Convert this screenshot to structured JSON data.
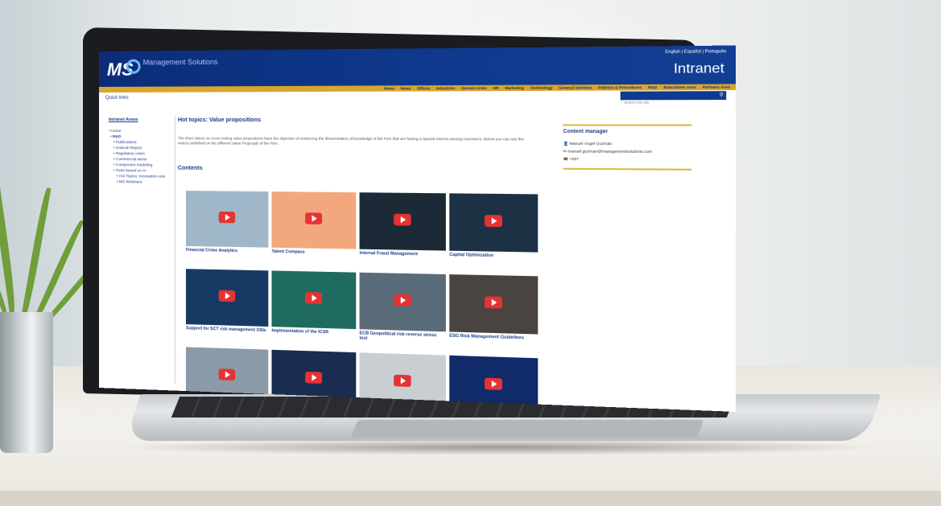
{
  "header": {
    "logo_mark": "MS",
    "logo_text": "Management Solutions",
    "languages": "English | Español | Português",
    "title": "Intranet"
  },
  "nav": [
    "Home",
    "News",
    "Offices",
    "Industries",
    "Service Lines",
    "HR",
    "Marketing",
    "Technology",
    "General Services",
    "Policies & Procedures",
    "R&D",
    "Executives Area",
    "Partners Area"
  ],
  "quick_links": "Quick links",
  "search": {
    "placeholder": "Search this site"
  },
  "sidebar": {
    "title": "Intranet Areas",
    "items": [
      "• Home",
      "• R&D",
      "• Publications",
      "• Outlook Report",
      "• Regulatory notes",
      "• Commercial alerts",
      "• Component modeling",
      "• Tools based on AI",
      "• Hot Topics: Innovation Axis",
      "• MS Webinars"
    ]
  },
  "main": {
    "title": "Hot topics: Value propositions",
    "intro": "The short videos on cross-cutting value propositions have the objective of reinforcing the dissemination of knowledge of the Firm that are having a special interest among customers. Below you can see the videos published on the different Value Proposals of the Firm.",
    "contents_label": "Contents",
    "cards": [
      {
        "caption": "Financial Crime Analytics",
        "bg": "#9fb7c9"
      },
      {
        "caption": "Talent Compass",
        "bg": "#f3a77d"
      },
      {
        "caption": "Internal Fraud Management",
        "bg": "#1c2a38"
      },
      {
        "caption": "Capital Optimization",
        "bg": "#1d3144"
      },
      {
        "caption": "Support for SCT risk management OSIs",
        "bg": "#163a63"
      },
      {
        "caption": "Implementation of the ICSR",
        "bg": "#1f6b62"
      },
      {
        "caption": "ECB Geopolitical risk reverse stress test",
        "bg": "#5a6b7a"
      },
      {
        "caption": "ESG Risk Management Guidelines",
        "bg": "#4a4440"
      },
      {
        "caption": "",
        "bg": "#8b9aa8"
      },
      {
        "caption": "",
        "bg": "#1a2c4f"
      },
      {
        "caption": "",
        "bg": "#c9ced3"
      },
      {
        "caption": "",
        "bg": "#102a6a"
      }
    ]
  },
  "content_manager": {
    "title": "Content manager",
    "name": "Manuel Ángel Guzmán",
    "email": "manuel.guzman@managementsolutions.com",
    "phone": "+597"
  }
}
